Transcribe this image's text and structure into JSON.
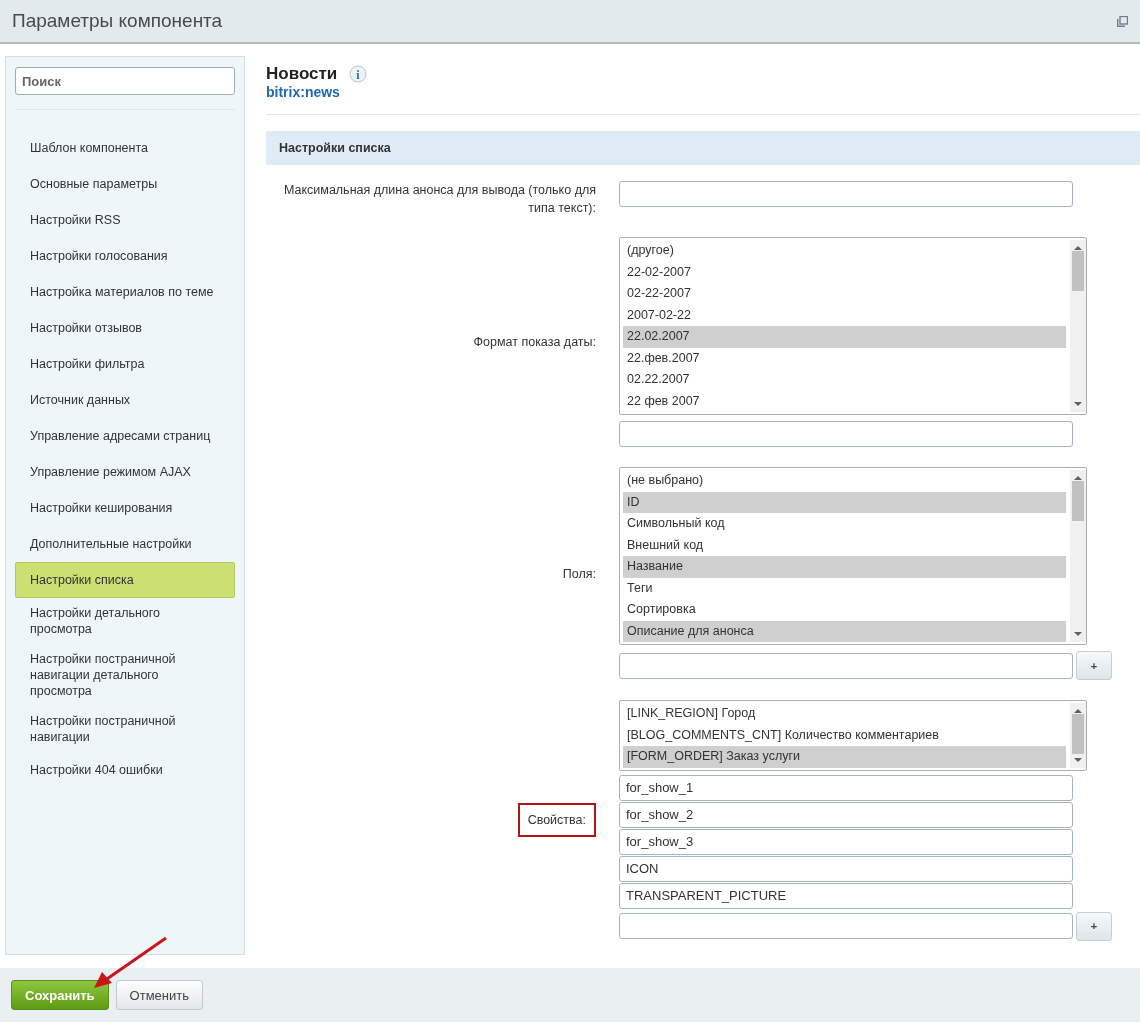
{
  "window": {
    "title": "Параметры компонента"
  },
  "sidebar": {
    "search": {
      "placeholder": "Поиск"
    },
    "items": [
      {
        "label": "Шаблон компонента",
        "selected": false
      },
      {
        "label": "Основные параметры",
        "selected": false
      },
      {
        "label": "Настройки RSS",
        "selected": false
      },
      {
        "label": "Настройки голосования",
        "selected": false
      },
      {
        "label": "Настройка материалов по теме",
        "selected": false
      },
      {
        "label": "Настройки отзывов",
        "selected": false
      },
      {
        "label": "Настройки фильтра",
        "selected": false
      },
      {
        "label": "Источник данных",
        "selected": false
      },
      {
        "label": "Управление адресами страниц",
        "selected": false
      },
      {
        "label": "Управление режимом AJAX",
        "selected": false
      },
      {
        "label": "Настройки кеширования",
        "selected": false
      },
      {
        "label": "Дополнительные настройки",
        "selected": false
      },
      {
        "label": "Настройки списка",
        "selected": true
      },
      {
        "label": "Настройки детального просмотра",
        "selected": false
      },
      {
        "label": "Настройки постраничной навигации детального просмотра",
        "selected": false
      },
      {
        "label": "Настройки постраничной навигации",
        "selected": false
      },
      {
        "label": "Настройки 404 ошибки",
        "selected": false
      }
    ]
  },
  "component": {
    "title": "Новости",
    "info_icon": "i",
    "code": "bitrix:news"
  },
  "section": {
    "title": "Настройки списка"
  },
  "fields": [
    {
      "kind": "text",
      "label": "Максимальная длина анонса для вывода (только для типа текст):",
      "highlighted": false
    },
    {
      "kind": "list",
      "label": "Формат показа даты:",
      "highlighted": false,
      "options": [
        {
          "label": "(другое)",
          "selected": false
        },
        {
          "label": "22-02-2007",
          "selected": false
        },
        {
          "label": "02-22-2007",
          "selected": false
        },
        {
          "label": "2007-02-22",
          "selected": false
        },
        {
          "label": "22.02.2007",
          "selected": true
        },
        {
          "label": "22.фев.2007",
          "selected": false
        },
        {
          "label": "02.22.2007",
          "selected": false
        },
        {
          "label": "22 фев 2007",
          "selected": false
        }
      ]
    },
    {
      "kind": "list",
      "label": "Поля:",
      "highlighted": false,
      "options": [
        {
          "label": "(не выбрано)",
          "selected": false
        },
        {
          "label": "ID",
          "selected": true
        },
        {
          "label": "Символьный код",
          "selected": false
        },
        {
          "label": "Внешний код",
          "selected": false
        },
        {
          "label": "Название",
          "selected": true
        },
        {
          "label": "Теги",
          "selected": false
        },
        {
          "label": "Сортировка",
          "selected": false
        },
        {
          "label": "Описание для анонса",
          "selected": true
        }
      ],
      "add_button": "+"
    },
    {
      "kind": "list",
      "label": "Свойства:",
      "highlighted": true,
      "options": [
        {
          "label": "[LINK_REGION] Город",
          "selected": false
        },
        {
          "label": "[BLOG_COMMENTS_CNT] Количество комментариев",
          "selected": false
        },
        {
          "label": "[FORM_ORDER] Заказ услуги",
          "selected": true
        }
      ],
      "values": [
        "for_show_1",
        "for_show_2",
        "for_show_3",
        "ICON",
        "TRANSPARENT_PICTURE"
      ],
      "add_button": "+"
    }
  ],
  "buttons": [
    {
      "label": "Сохранить",
      "kind": "primary"
    },
    {
      "label": "Отменить",
      "kind": "secondary"
    }
  ]
}
